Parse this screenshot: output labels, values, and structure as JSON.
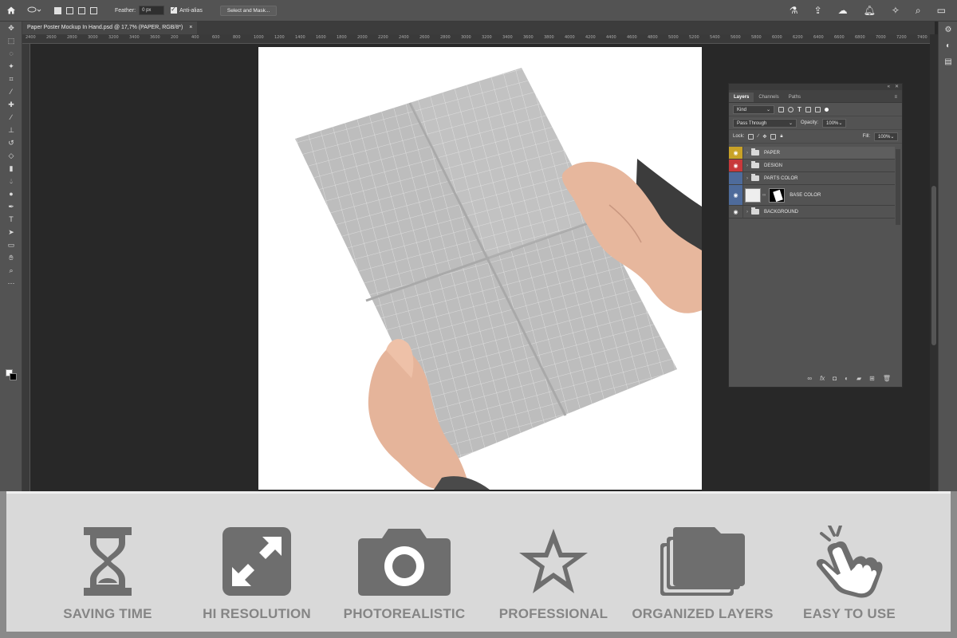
{
  "options_bar": {
    "feather_label": "Feather:",
    "feather_value": "0 px",
    "antialias_label": "Anti-alias",
    "select_mask_label": "Select and Mask..."
  },
  "document_tab": {
    "title": "Paper Poster Mockup In Hand.psd @ 17,7% (PAPER, RGB/8*)",
    "close": "×"
  },
  "ruler_ticks": [
    "2400",
    "2600",
    "2800",
    "3000",
    "3200",
    "3400",
    "3600",
    "200",
    "400",
    "600",
    "800",
    "1000",
    "1200",
    "1400",
    "1600",
    "1800",
    "2000",
    "2200",
    "2400",
    "2600",
    "2800",
    "3000",
    "3200",
    "3400",
    "3600",
    "3800",
    "4000",
    "4200",
    "4400",
    "4600",
    "4800",
    "5000",
    "5200",
    "5400",
    "5600",
    "5800",
    "6000",
    "6200",
    "6400",
    "6600",
    "6800",
    "7000",
    "7200",
    "7400"
  ],
  "layers_panel": {
    "tabs": [
      "Layers",
      "Channels",
      "Paths"
    ],
    "filter_label": "Kind",
    "blend_mode": "Pass Through",
    "opacity_label": "Opacity:",
    "opacity_value": "100%",
    "lock_label": "Lock:",
    "fill_label": "Fill:",
    "fill_value": "100%",
    "layers": [
      {
        "name": "PAPER",
        "color": "#c9a227"
      },
      {
        "name": "DESIGN",
        "color": "#c8393b"
      },
      {
        "name": "PARTS COLOR",
        "color": "#4e6b9b"
      },
      {
        "name": "BASE COLOR",
        "color": "#4e6b9b"
      },
      {
        "name": "BACKGROUND",
        "color": "#535353"
      }
    ]
  },
  "features": [
    {
      "label": "SAVING TIME",
      "icon": "hourglass-icon"
    },
    {
      "label": "HI RESOLUTION",
      "icon": "expand-arrows-icon"
    },
    {
      "label": "PHOTOREALISTIC",
      "icon": "camera-icon"
    },
    {
      "label": "PROFESSIONAL",
      "icon": "star-icon"
    },
    {
      "label": "ORGANIZED LAYERS",
      "icon": "layers-folder-icon"
    },
    {
      "label": "EASY TO USE",
      "icon": "tap-hand-icon"
    }
  ],
  "colors": {
    "feature_icon": "#6e6e6e",
    "feature_label": "#858585",
    "strip_background": "#d9d9d9"
  }
}
